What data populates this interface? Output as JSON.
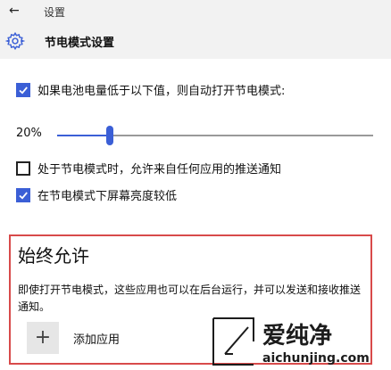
{
  "titlebar": {
    "back_icon": "back-arrow-icon",
    "title": "设置"
  },
  "header": {
    "icon": "gear-icon",
    "title": "节电模式设置"
  },
  "auto_enable": {
    "checked": true,
    "label": "如果电池电量低于以下值，则自动打开节电模式:"
  },
  "threshold": {
    "value_text": "20%",
    "value": 20
  },
  "allow_push": {
    "checked": false,
    "label": "处于节电模式时，允许来自任何应用的推送通知"
  },
  "lower_brightness": {
    "checked": true,
    "label": "在节电模式下屏幕亮度较低"
  },
  "always_allowed": {
    "heading": "始终允许",
    "description": "即使打开节电模式，这些应用也可以在后台运行，并可以发送和接收推送通知。",
    "add_label": "添加应用",
    "add_icon": "plus-icon"
  },
  "watermark": {
    "brand": "爱纯净",
    "url": "aichunjing.com"
  },
  "colors": {
    "accent": "#3b5fd6",
    "highlight_border": "#d84a4a",
    "header_bg": "#f2f2f2"
  }
}
